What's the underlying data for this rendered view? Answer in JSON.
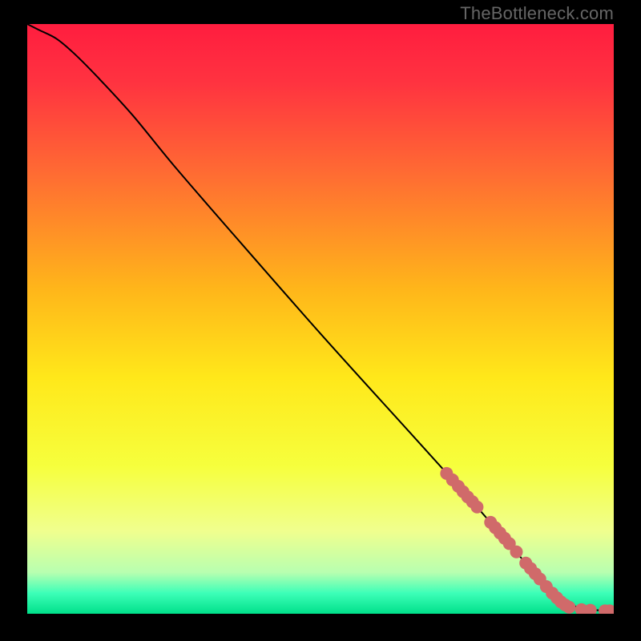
{
  "attribution": "TheBottleneck.com",
  "chart_data": {
    "type": "line",
    "title": "",
    "xlabel": "",
    "ylabel": "",
    "xlim": [
      0,
      100
    ],
    "ylim": [
      0,
      100
    ],
    "background_gradient": {
      "stops": [
        {
          "offset": 0.0,
          "color": "#ff1d3f"
        },
        {
          "offset": 0.1,
          "color": "#ff3340"
        },
        {
          "offset": 0.25,
          "color": "#ff6a33"
        },
        {
          "offset": 0.45,
          "color": "#ffb61a"
        },
        {
          "offset": 0.6,
          "color": "#ffe81a"
        },
        {
          "offset": 0.75,
          "color": "#f6ff3d"
        },
        {
          "offset": 0.86,
          "color": "#f0ff8e"
        },
        {
          "offset": 0.93,
          "color": "#b8ffb0"
        },
        {
          "offset": 0.965,
          "color": "#3dffb8"
        },
        {
          "offset": 1.0,
          "color": "#00e08a"
        }
      ]
    },
    "curve": {
      "x": [
        0,
        2,
        5,
        8,
        12,
        18,
        25,
        35,
        50,
        65,
        75,
        82,
        86,
        89,
        92,
        95,
        100
      ],
      "y": [
        100,
        99,
        97.5,
        95,
        91,
        84.5,
        76,
        64.5,
        47.5,
        31,
        20,
        12,
        7.5,
        4.5,
        2,
        0.8,
        0.5
      ]
    },
    "series": [
      {
        "name": "markers",
        "color": "#d06a6a",
        "points": [
          {
            "x": 71.5,
            "y": 23.8
          },
          {
            "x": 72.5,
            "y": 22.7
          },
          {
            "x": 73.5,
            "y": 21.6
          },
          {
            "x": 74.3,
            "y": 20.7
          },
          {
            "x": 75.1,
            "y": 19.8
          },
          {
            "x": 75.9,
            "y": 19.0
          },
          {
            "x": 76.7,
            "y": 18.1
          },
          {
            "x": 79.0,
            "y": 15.5
          },
          {
            "x": 79.8,
            "y": 14.6
          },
          {
            "x": 80.6,
            "y": 13.7
          },
          {
            "x": 81.4,
            "y": 12.8
          },
          {
            "x": 82.2,
            "y": 11.9
          },
          {
            "x": 83.4,
            "y": 10.5
          },
          {
            "x": 85.0,
            "y": 8.6
          },
          {
            "x": 85.8,
            "y": 7.7
          },
          {
            "x": 86.6,
            "y": 6.8
          },
          {
            "x": 87.4,
            "y": 5.9
          },
          {
            "x": 88.5,
            "y": 4.6
          },
          {
            "x": 89.5,
            "y": 3.5
          },
          {
            "x": 90.3,
            "y": 2.7
          },
          {
            "x": 91.0,
            "y": 2.0
          },
          {
            "x": 91.7,
            "y": 1.5
          },
          {
            "x": 92.4,
            "y": 1.1
          },
          {
            "x": 94.5,
            "y": 0.7
          },
          {
            "x": 96.0,
            "y": 0.6
          },
          {
            "x": 98.5,
            "y": 0.5
          },
          {
            "x": 99.3,
            "y": 0.5
          }
        ]
      }
    ]
  }
}
